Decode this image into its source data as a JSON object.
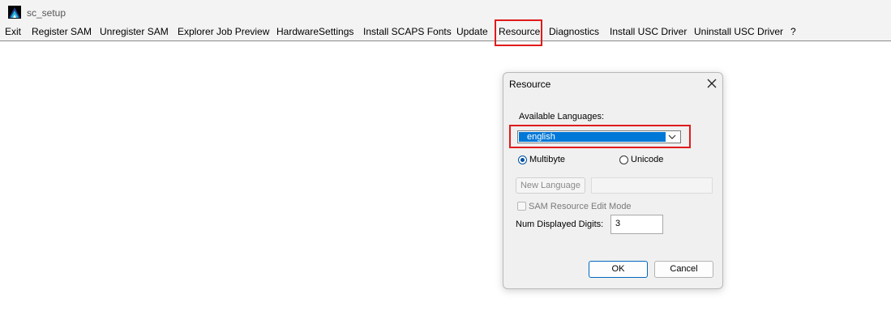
{
  "window": {
    "title": "sc_setup",
    "icon": "mountain-app-icon"
  },
  "menu": {
    "items": [
      "Exit",
      "Register SAM",
      "Unregister SAM",
      "Explorer Job Preview",
      "HardwareSettings",
      "Install SCAPS Fonts",
      "Update",
      "Resource",
      "Diagnostics",
      "Install USC Driver",
      "Uninstall USC Driver",
      "?"
    ],
    "highlighted": "Resource"
  },
  "dialog": {
    "title": "Resource",
    "available_languages_label": "Available Languages:",
    "language_selected": "english",
    "radio_multibyte": "Multibyte",
    "radio_unicode": "Unicode",
    "radio_selected": "Multibyte",
    "new_language_button": "New Language",
    "new_language_value": "",
    "sam_edit_mode_label": "SAM Resource Edit Mode",
    "sam_edit_mode_checked": false,
    "num_digits_label": "Num Displayed Digits:",
    "num_digits_value": "3",
    "ok_button": "OK",
    "cancel_button": "Cancel"
  },
  "colors": {
    "highlight": "#e01b1b",
    "selection": "#0078d7",
    "accent": "#0067c0"
  }
}
